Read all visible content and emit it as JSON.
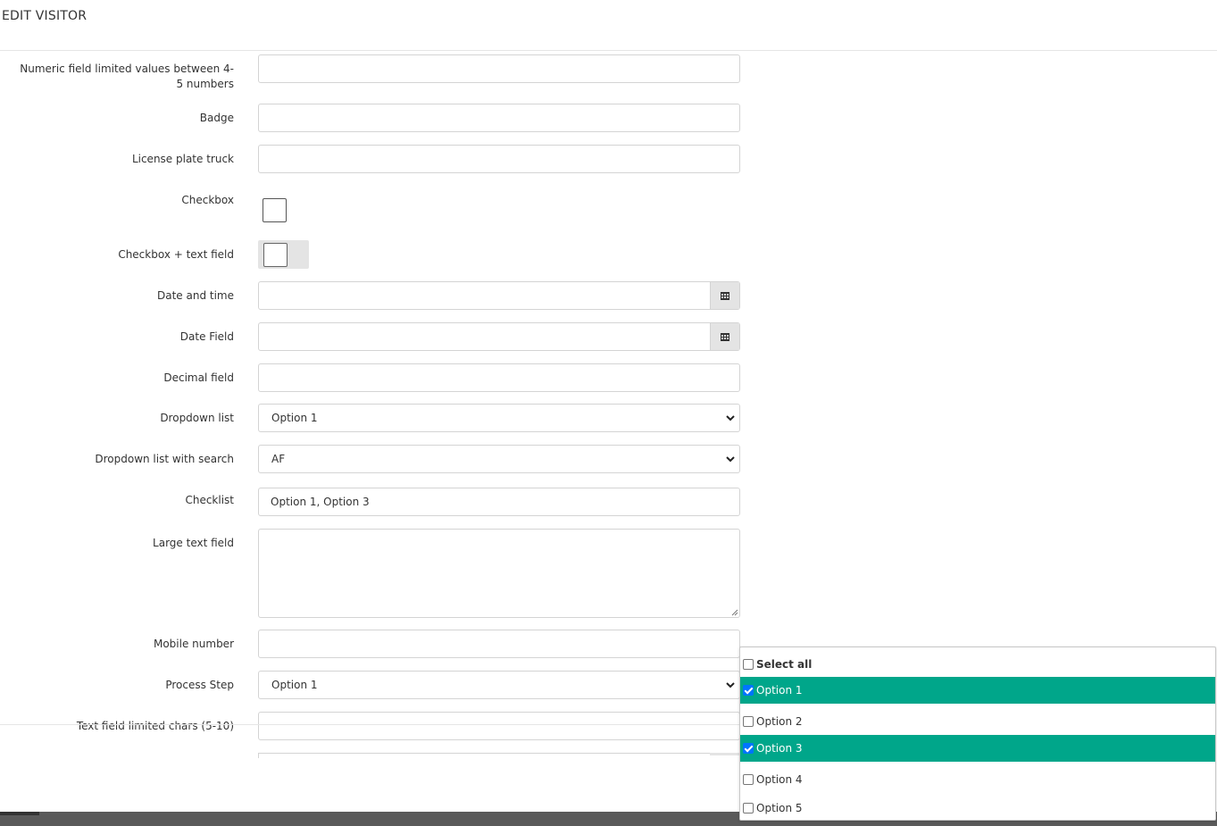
{
  "header": {
    "title": "EDIT VISITOR"
  },
  "fields": {
    "numeric": {
      "label": "Numeric field limited values between 4-5 numbers",
      "value": ""
    },
    "badge": {
      "label": "Badge",
      "value": ""
    },
    "license_plate": {
      "label": "License plate truck",
      "value": ""
    },
    "checkbox": {
      "label": "Checkbox",
      "checked": false
    },
    "checkbox_text": {
      "label": "Checkbox + text field",
      "checked": false
    },
    "date_time": {
      "label": "Date and time",
      "value": "",
      "icon": "calendar-icon"
    },
    "date_field": {
      "label": "Date Field",
      "value": "",
      "icon": "calendar-icon"
    },
    "decimal": {
      "label": "Decimal field",
      "value": ""
    },
    "dropdown": {
      "label": "Dropdown list",
      "value": "Option 1"
    },
    "dropdown_search": {
      "label": "Dropdown list with search",
      "value": "AF"
    },
    "checklist": {
      "label": "Checklist",
      "value": "Option 1, Option 3"
    },
    "large_text": {
      "label": "Large text field",
      "value": ""
    },
    "mobile": {
      "label": "Mobile number",
      "value": ""
    },
    "process_step": {
      "label": "Process Step",
      "value": "Option 1"
    },
    "text_limited": {
      "label": "Text field limited chars (5-10)",
      "value": ""
    }
  },
  "checklist_dropdown": {
    "select_all": {
      "label": "Select all",
      "checked": false
    },
    "options": [
      {
        "label": "Option 1",
        "checked": true
      },
      {
        "label": "Option 2",
        "checked": false
      },
      {
        "label": "Option 3",
        "checked": true
      },
      {
        "label": "Option 4",
        "checked": false
      },
      {
        "label": "Option 5",
        "checked": false
      }
    ]
  },
  "colors": {
    "selected_row": "#00a68a",
    "checkbox_on": "#0075ff"
  }
}
